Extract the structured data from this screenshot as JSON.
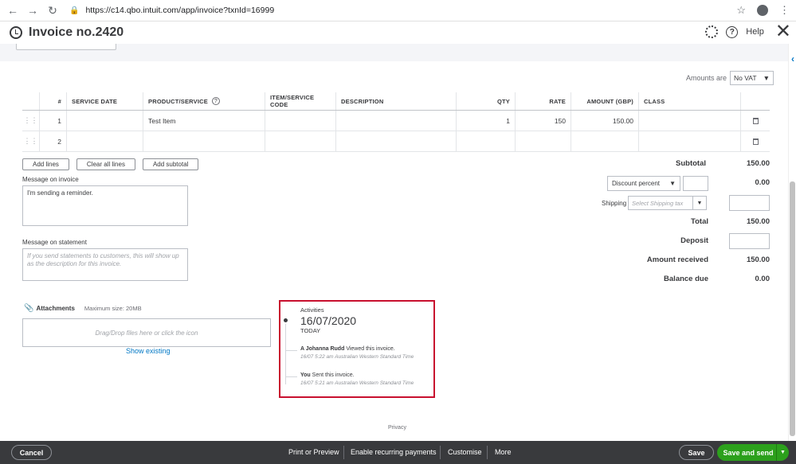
{
  "browser": {
    "url": "https://c14.qbo.intuit.com/app/invoice?txnId=16999"
  },
  "header": {
    "title": "Invoice no.2420",
    "help_label": "Help"
  },
  "amounts_are": {
    "label": "Amounts are",
    "value": "No VAT"
  },
  "table": {
    "headers": {
      "num": "#",
      "service_date": "SERVICE DATE",
      "product": "PRODUCT/SERVICE",
      "item_code": "ITEM/SERVICE CODE",
      "description": "DESCRIPTION",
      "qty": "QTY",
      "rate": "RATE",
      "amount": "AMOUNT (GBP)",
      "class": "CLASS"
    },
    "rows": [
      {
        "num": "1",
        "service_date": "",
        "product": "Test Item",
        "item_code": "",
        "description": "",
        "qty": "1",
        "rate": "150",
        "amount": "150.00",
        "class": ""
      },
      {
        "num": "2",
        "service_date": "",
        "product": "",
        "item_code": "",
        "description": "",
        "qty": "",
        "rate": "",
        "amount": "",
        "class": ""
      }
    ]
  },
  "line_buttons": {
    "add_lines": "Add lines",
    "clear_all": "Clear all lines",
    "add_subtotal": "Add subtotal"
  },
  "message_invoice": {
    "label": "Message on invoice",
    "value": "I'm sending a reminder."
  },
  "message_statement": {
    "label": "Message on statement",
    "placeholder": "If you send statements to customers, this will show up as the description for this invoice."
  },
  "totals": {
    "subtotal_label": "Subtotal",
    "subtotal": "150.00",
    "discount_type": "Discount percent",
    "discount_value": "0.00",
    "shipping_label": "Shipping",
    "shipping_tax_placeholder": "Select Shipping tax",
    "total_label": "Total",
    "total": "150.00",
    "deposit_label": "Deposit",
    "amount_received_label": "Amount received",
    "amount_received": "150.00",
    "balance_due_label": "Balance due",
    "balance_due": "0.00"
  },
  "attachments": {
    "label": "Attachments",
    "max_size": "Maximum size: 20MB",
    "dropzone": "Drag/Drop files here or click the icon",
    "show_existing": "Show existing"
  },
  "activities": {
    "title": "Activities",
    "date": "16/07/2020",
    "today": "TODAY",
    "items": [
      {
        "actor": "A Johanna Rudd",
        "action": "Viewed this invoice.",
        "time": "16/07 5:22 am Australian Western Standard Time"
      },
      {
        "actor": "You",
        "action": "Sent this invoice.",
        "time": "16/07 5:21 am Australian Western Standard Time"
      }
    ]
  },
  "privacy": "Privacy",
  "footer": {
    "cancel": "Cancel",
    "print": "Print or Preview",
    "recurring": "Enable recurring payments",
    "customise": "Customise",
    "more": "More",
    "save": "Save",
    "save_send": "Save and send"
  },
  "colors": {
    "highlight_border": "#c8102e",
    "link": "#0077c5",
    "primary_green": "#2ca01c",
    "footer_bg": "#393a3d"
  }
}
